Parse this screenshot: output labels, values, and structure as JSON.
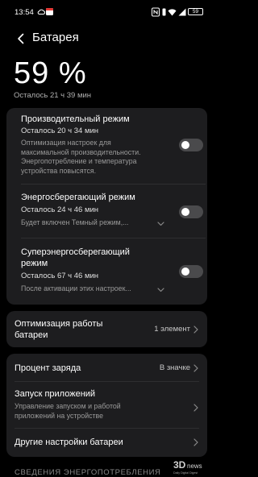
{
  "status_bar": {
    "time": "13:54",
    "battery_badge": "59"
  },
  "header": {
    "title": "Батарея"
  },
  "battery": {
    "percent": "59 %",
    "remaining": "Осталось 21 ч 39 мин"
  },
  "modes": [
    {
      "title": "Производительный режим",
      "remaining": "Осталось 20 ч 34 мин",
      "desc_lines": [
        "Оптимизация настроек для",
        "максимальной производительности.",
        "Энергопотребление и температура",
        "устройства повысятся."
      ],
      "enabled": false
    },
    {
      "title": "Энергосберегающий режим",
      "remaining": "Осталось 24 ч 46 мин",
      "desc_lines": [
        "Будет включен Темный режим,..."
      ],
      "enabled": false
    },
    {
      "title_lines": [
        "Суперэнергосберегающий",
        "режим"
      ],
      "remaining": "Осталось 67 ч 46 мин",
      "desc_lines": [
        "После активации этих настроек..."
      ],
      "enabled": false
    }
  ],
  "optimization": {
    "title_lines": [
      "Оптимизация работы",
      "батареи"
    ],
    "value": "1 элемент"
  },
  "settings": {
    "charge_percent": {
      "label": "Процент заряда",
      "value": "В значке"
    },
    "app_launch": {
      "label": "Запуск приложений",
      "desc_lines": [
        "Управление запуском и работой",
        "приложений на устройстве"
      ]
    },
    "other": {
      "label": "Другие настройки батареи"
    }
  },
  "section_header": "СВЕДЕНИЯ ЭНЕРГОПОТРЕБЛЕНИЯ",
  "watermark": {
    "brand": "3D",
    "suffix": "news",
    "tagline": "Daily Digital Digest"
  },
  "colors": {
    "background": "#000000",
    "card": "#1d1d1f",
    "toggle_off": "#4a4a4c",
    "secondary_text": "#9a9a9a",
    "calendar_accent": "#e53935"
  }
}
